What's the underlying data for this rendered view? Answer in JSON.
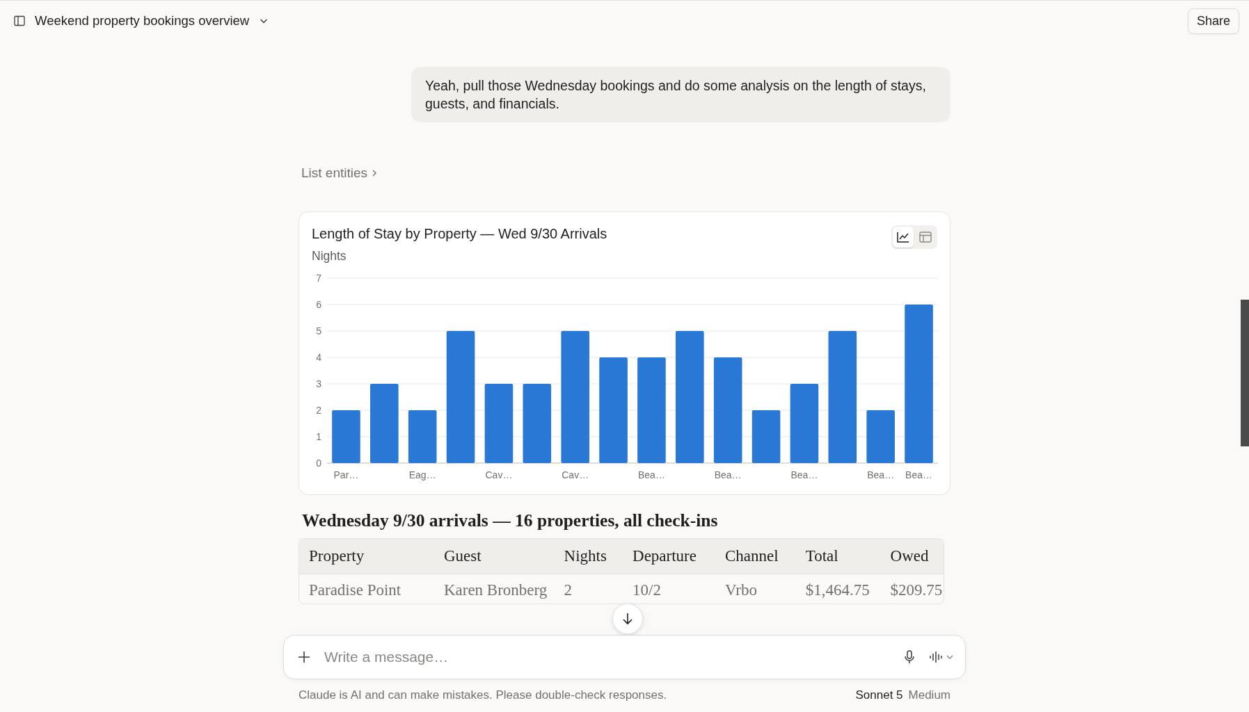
{
  "header": {
    "title": "Weekend property bookings overview",
    "share_label": "Share"
  },
  "user_message": "Yeah, pull those Wednesday bookings and do some analysis on the length of stays, guests, and financials.",
  "tool_call": {
    "label": "List entities"
  },
  "chart_card": {
    "view_toggle": [
      {
        "kind": "chart",
        "selected": true
      },
      {
        "kind": "table",
        "selected": false
      }
    ],
    "chart_data": {
      "type": "bar",
      "title": "Length of Stay by Property — Wed 9/30 Arrivals",
      "ylabel": "Nights",
      "categories": [
        "Par…",
        null,
        "Eag…",
        null,
        "Cav…",
        null,
        "Cav…",
        null,
        "Bea…",
        null,
        "Bea…",
        null,
        "Bea…",
        null,
        "Bea…",
        "Bea…"
      ],
      "series": [
        {
          "color": "#2a78d6",
          "values": [
            2,
            3,
            2,
            5,
            3,
            3,
            5,
            4,
            4,
            5,
            4,
            2,
            3,
            5,
            2,
            6
          ]
        }
      ],
      "ylim": [
        0,
        7
      ],
      "yticks": [
        0,
        1,
        2,
        3,
        4,
        5,
        6,
        7
      ],
      "grid": true
    }
  },
  "table_heading": "Wednesday 9/30 arrivals — 16 properties, all check-ins",
  "table": {
    "columns": [
      "Property",
      "Guest",
      "Nights",
      "Departure",
      "Channel",
      "Total",
      "Owed"
    ],
    "rows": [
      [
        "Paradise Point",
        "Karen Bronberg",
        "2",
        "10/2",
        "Vrbo",
        "$1,464.75",
        "$209.75"
      ]
    ]
  },
  "composer": {
    "placeholder": "Write a message…"
  },
  "disclaimer": "Claude is AI and can make mistakes. Please double-check responses.",
  "model": {
    "name": "Sonnet 5",
    "effort": "Medium"
  }
}
